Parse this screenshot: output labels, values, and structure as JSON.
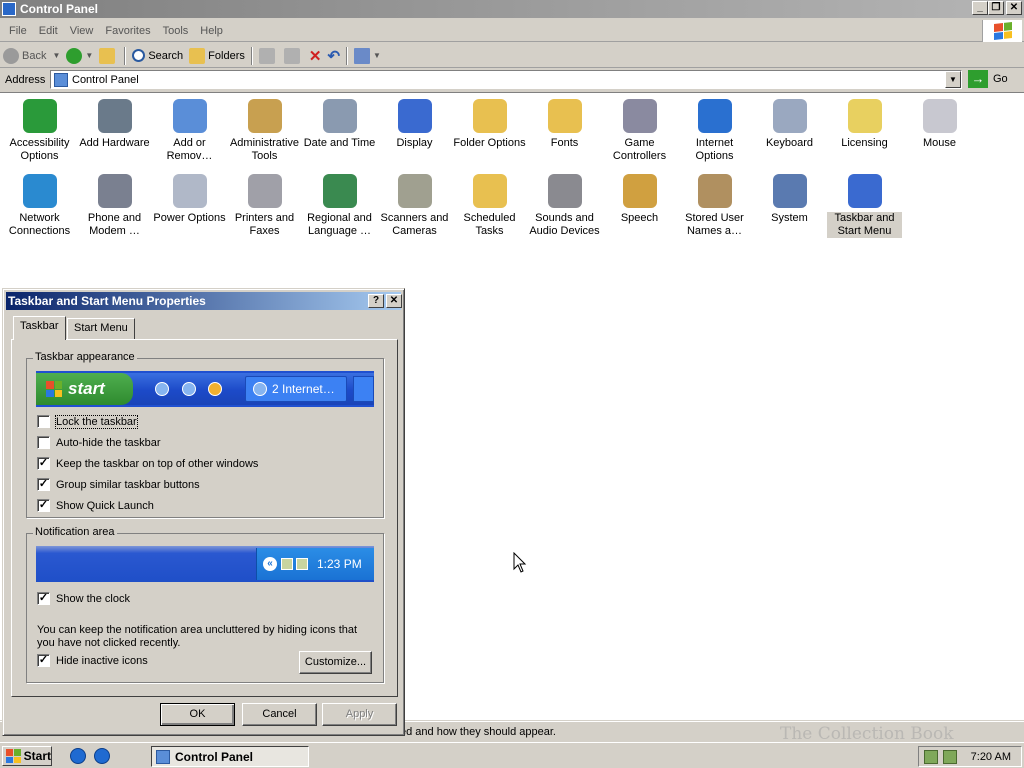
{
  "window": {
    "title": "Control Panel",
    "controls": {
      "minimize": "_",
      "maximize": "❐",
      "close": "✕"
    }
  },
  "menubar": [
    "File",
    "Edit",
    "View",
    "Favorites",
    "Tools",
    "Help"
  ],
  "toolbar": {
    "back": "Back",
    "search": "Search",
    "folders": "Folders"
  },
  "address": {
    "label": "Address",
    "value": "Control Panel",
    "go": "Go"
  },
  "items": [
    {
      "label": "Accessibility Options",
      "color": "#2a9a3a"
    },
    {
      "label": "Add Hardware",
      "color": "#6a7a8a"
    },
    {
      "label": "Add or Remov…",
      "color": "#5a8ed8"
    },
    {
      "label": "Administrative Tools",
      "color": "#c8a050"
    },
    {
      "label": "Date and Time",
      "color": "#8a9ab0"
    },
    {
      "label": "Display",
      "color": "#3a6ad0"
    },
    {
      "label": "Folder Options",
      "color": "#e8c050"
    },
    {
      "label": "Fonts",
      "color": "#e8c050"
    },
    {
      "label": "Game Controllers",
      "color": "#8a8aa0"
    },
    {
      "label": "Internet Options",
      "color": "#2a70d0"
    },
    {
      "label": "Keyboard",
      "color": "#9aa8c0"
    },
    {
      "label": "Licensing",
      "color": "#e8d060"
    },
    {
      "label": "Mouse",
      "color": "#c8c8d0"
    },
    {
      "label": "Network Connections",
      "color": "#2a8ad0"
    },
    {
      "label": "Phone and Modem …",
      "color": "#7a8090"
    },
    {
      "label": "Power Options",
      "color": "#b0b8c8"
    },
    {
      "label": "Printers and Faxes",
      "color": "#a0a0a8"
    },
    {
      "label": "Regional and Language …",
      "color": "#3a8a50"
    },
    {
      "label": "Scanners and Cameras",
      "color": "#a0a090"
    },
    {
      "label": "Scheduled Tasks",
      "color": "#e8c050"
    },
    {
      "label": "Sounds and Audio Devices",
      "color": "#8a8a90"
    },
    {
      "label": "Speech",
      "color": "#d0a040"
    },
    {
      "label": "Stored User Names a…",
      "color": "#b09060"
    },
    {
      "label": "System",
      "color": "#5a7ab0"
    },
    {
      "label": "Taskbar and Start Menu",
      "color": "#3a6ad0",
      "selected": true
    }
  ],
  "statusbar": {
    "text": "ed and how they should appear."
  },
  "watermark": "The Collection Book",
  "dialog": {
    "title": "Taskbar and Start Menu Properties",
    "help": "?",
    "close": "✕",
    "tabs": [
      "Taskbar",
      "Start Menu"
    ],
    "appearance": {
      "legend": "Taskbar appearance",
      "preview_start": "start",
      "preview_window": "2 Internet…",
      "options": [
        {
          "label": "Lock the taskbar",
          "checked": false
        },
        {
          "label": "Auto-hide the taskbar",
          "checked": false
        },
        {
          "label": "Keep the taskbar on top of other windows",
          "checked": true
        },
        {
          "label": "Group similar taskbar buttons",
          "checked": true
        },
        {
          "label": "Show Quick Launch",
          "checked": true
        }
      ]
    },
    "notification": {
      "legend": "Notification area",
      "preview_time": "1:23 PM",
      "show_clock": {
        "label": "Show the clock",
        "checked": true
      },
      "description": "You can keep the notification area uncluttered by hiding icons that you have not clicked recently.",
      "hide_inactive": {
        "label": "Hide inactive icons",
        "checked": true
      },
      "customize": "Customize..."
    },
    "buttons": {
      "ok": "OK",
      "cancel": "Cancel",
      "apply": "Apply"
    }
  },
  "taskbar": {
    "start": "Start",
    "task": "Control Panel",
    "time": "7:20 AM"
  }
}
